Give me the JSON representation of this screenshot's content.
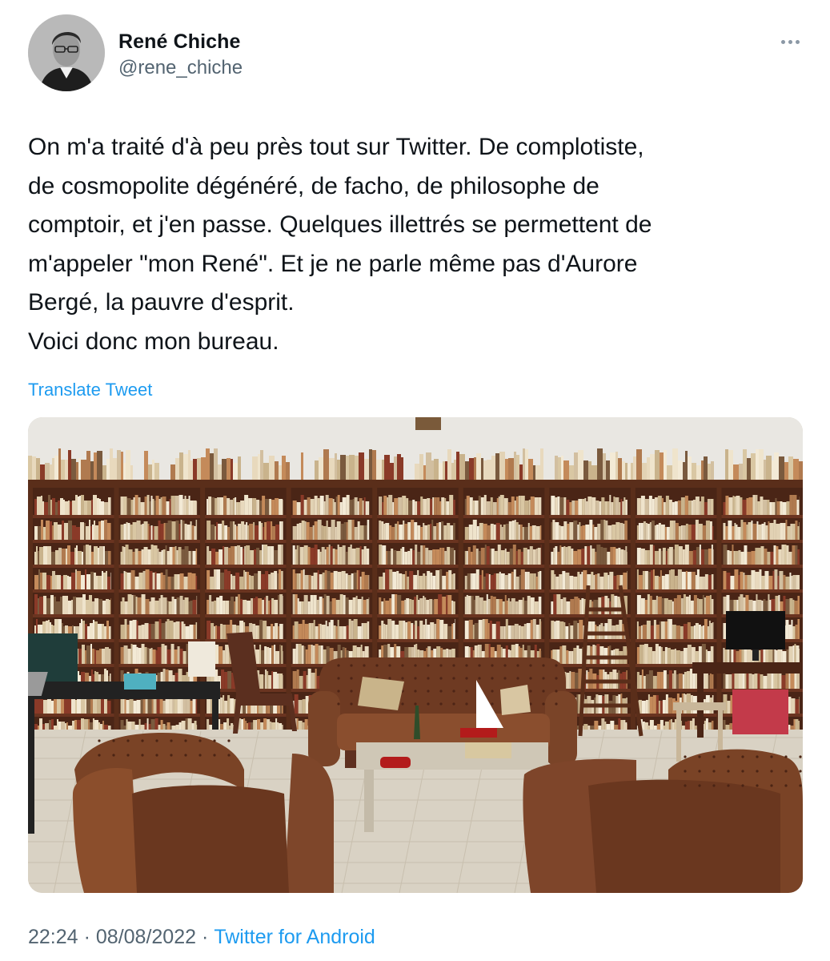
{
  "tweet": {
    "author": {
      "name": "René Chiche",
      "handle": "@rene_chiche"
    },
    "text_lines": [
      "On m'a traité d'à peu près tout sur Twitter. De complotiste,",
      "de cosmopolite dégénéré, de facho, de philosophe de",
      "comptoir, et j'en passe. Quelques illettrés se permettent de",
      "m'appeler \"mon René\". Et je ne parle même pas d'Aurore",
      "Bergé, la pauvre d'esprit.",
      "Voici donc mon bureau."
    ],
    "translate_label": "Translate Tweet",
    "meta": {
      "time": "22:24",
      "date": "08/08/2022",
      "separator": "·",
      "source": "Twitter for Android"
    }
  },
  "colors": {
    "link": "#1d9bf0",
    "secondary_text": "#536471",
    "primary_text": "#0f1419"
  },
  "icons": {
    "more": "more-horizontal-icon"
  }
}
